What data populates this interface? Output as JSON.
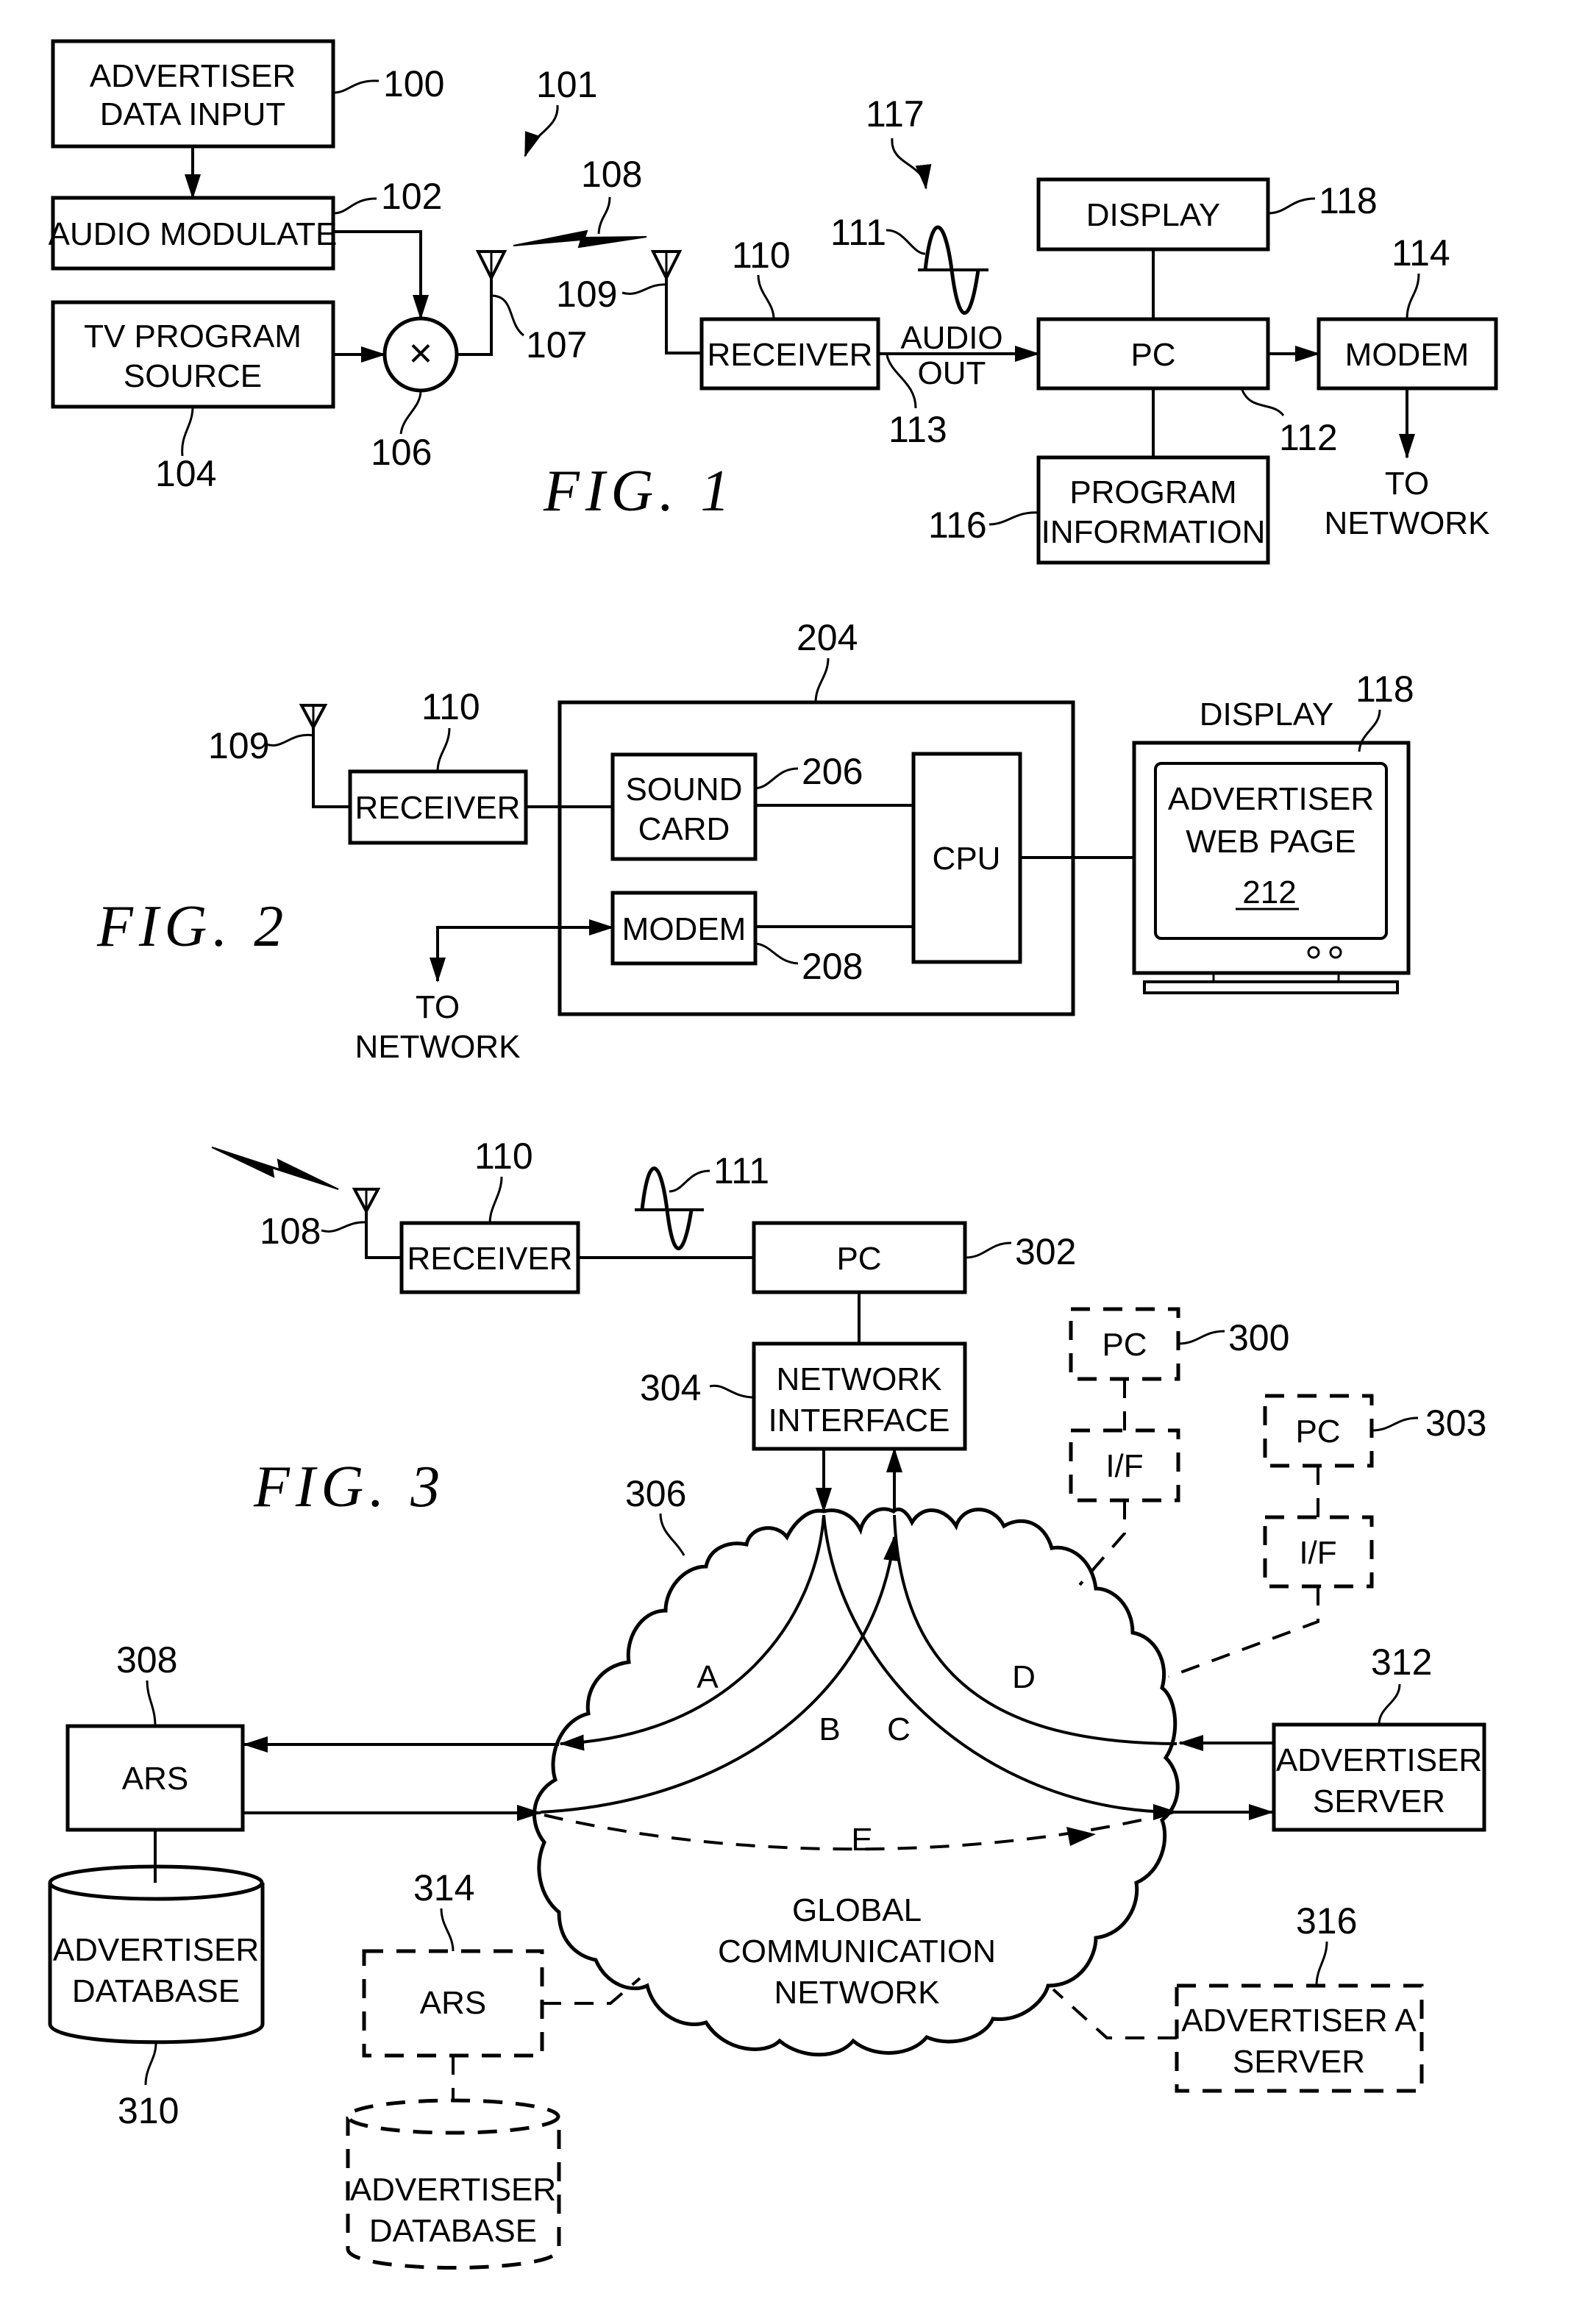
{
  "fig1": {
    "title": "FIG. 1",
    "blocks": {
      "advertiser_data_input": [
        "ADVERTISER",
        "DATA INPUT"
      ],
      "audio_modulate": [
        "AUDIO MODULATE"
      ],
      "tv_program_source": [
        "TV PROGRAM",
        "SOURCE"
      ],
      "receiver": [
        "RECEIVER"
      ],
      "audio_out": [
        "AUDIO",
        "OUT"
      ],
      "display": [
        "DISPLAY"
      ],
      "pc": [
        "PC"
      ],
      "modem": [
        "MODEM"
      ],
      "program_information": [
        "PROGRAM",
        "INFORMATION"
      ],
      "to_network": [
        "TO",
        "NETWORK"
      ],
      "multiplier_symbol": "×"
    },
    "refs": {
      "r100": "100",
      "r101": "101",
      "r102": "102",
      "r104": "104",
      "r106": "106",
      "r107": "107",
      "r108": "108",
      "r109": "109",
      "r110": "110",
      "r111": "111",
      "r112": "112",
      "r113": "113",
      "r114": "114",
      "r116": "116",
      "r117": "117",
      "r118": "118"
    }
  },
  "fig2": {
    "title": "FIG. 2",
    "blocks": {
      "receiver": [
        "RECEIVER"
      ],
      "sound_card": [
        "SOUND",
        "CARD"
      ],
      "modem": [
        "MODEM"
      ],
      "cpu": [
        "CPU"
      ],
      "display_label": "DISPLAY",
      "screen": [
        "ADVERTISER",
        "WEB PAGE"
      ],
      "screen_ref": "212",
      "to_network": [
        "TO",
        "NETWORK"
      ]
    },
    "refs": {
      "r109": "109",
      "r110": "110",
      "r118": "118",
      "r204": "204",
      "r206": "206",
      "r208": "208"
    }
  },
  "fig3": {
    "title": "FIG. 3",
    "blocks": {
      "receiver": [
        "RECEIVER"
      ],
      "pc302": [
        "PC"
      ],
      "network_interface": [
        "NETWORK",
        "INTERFACE"
      ],
      "pc300": [
        "PC"
      ],
      "if300": [
        "I/F"
      ],
      "pc303": [
        "PC"
      ],
      "if303": [
        "I/F"
      ],
      "ars308": [
        "ARS"
      ],
      "db310": [
        "ADVERTISER",
        "DATABASE"
      ],
      "ars314": [
        "ARS"
      ],
      "db314": [
        "ADVERTISER",
        "DATABASE"
      ],
      "advertiser_server": [
        "ADVERTISER",
        "SERVER"
      ],
      "advertiser_a_server": [
        "ADVERTISER A",
        "SERVER"
      ],
      "network": [
        "GLOBAL",
        "COMMUNICATION",
        "NETWORK"
      ]
    },
    "paths": {
      "a": "A",
      "b": "B",
      "c": "C",
      "d": "D",
      "e": "E"
    },
    "refs": {
      "r108": "108",
      "r110": "110",
      "r111": "111",
      "r300": "300",
      "r302": "302",
      "r303": "303",
      "r304": "304",
      "r306": "306",
      "r308": "308",
      "r310": "310",
      "r312": "312",
      "r314": "314",
      "r316": "316"
    }
  }
}
